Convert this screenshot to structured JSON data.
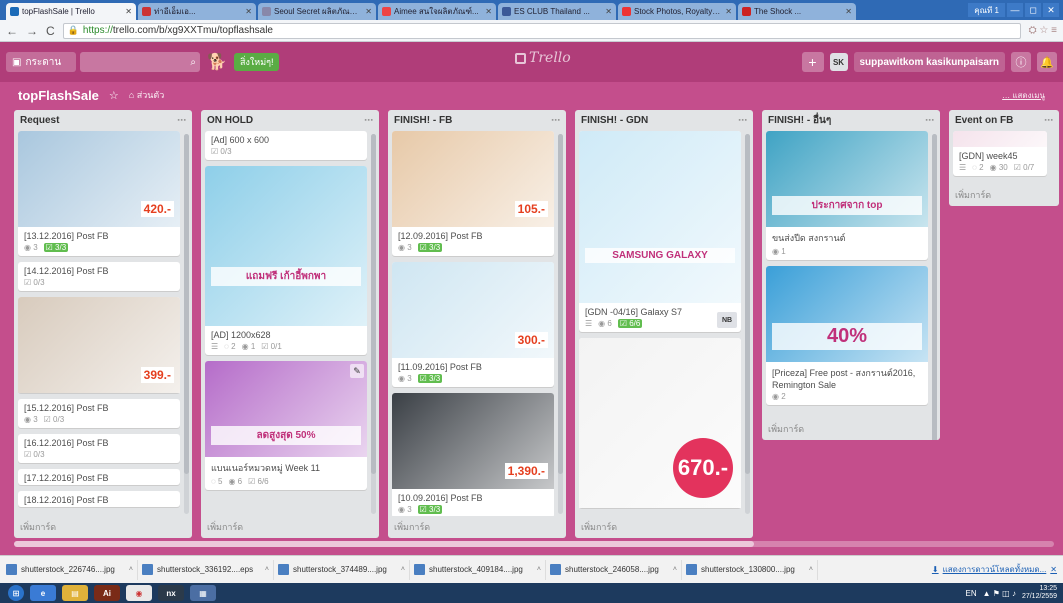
{
  "browser": {
    "tabs": [
      {
        "title": "topFlashSale | Trello",
        "color": "#1c6bb8",
        "active": true
      },
      {
        "title": "ท่าอีเอ็มเอ...",
        "color": "#c33",
        "active": false
      },
      {
        "title": "Seoul Secret ผลิตภัณฑ์...",
        "color": "#88a",
        "active": false
      },
      {
        "title": "Aimee สนใจผลิตภัณฑ์...",
        "color": "#e44",
        "active": false
      },
      {
        "title": "ES CLUB Thailand ...",
        "color": "#3b5998",
        "active": false
      },
      {
        "title": "Stock Photos, Royalty-Fr...",
        "color": "#e33",
        "active": false
      },
      {
        "title": "The Shock ...",
        "color": "#c22",
        "active": false
      }
    ],
    "user": "คุณที 1",
    "min": "—",
    "max": "◻",
    "close": "✕",
    "back": "←",
    "forward": "→",
    "reload": "C",
    "url_scheme": "https://",
    "url_rest": "trello.com/b/xg9XXTmu/topflashsale",
    "ext": "⛭ ☆ ≡"
  },
  "header": {
    "boards_label": "กระดาน",
    "search_icon": "⌕",
    "tip_label": "สิ่งใหม่ๆ!",
    "logo": "Trello",
    "plus": "+",
    "avatar": "SK",
    "username": "suppawitkom kasikunpaisarn",
    "info": "ⓘ",
    "bell": "🔔"
  },
  "board": {
    "title": "topFlashSale",
    "star": "☆",
    "visibility": "⌂ ส่วนตัว",
    "menu": "… แสดงเมนู"
  },
  "lists": [
    {
      "name": "Request",
      "add": "เพิ่มการ์ด",
      "cards": [
        {
          "title": "[13.12.2016] Post FB",
          "img": "#a9c7de",
          "price": "420.-",
          "badges": [
            "◉ 3",
            "☑ 3/3"
          ],
          "done": true
        },
        {
          "title": "[14.12.2016] Post FB",
          "badges": [
            "☑ 0/3"
          ],
          "done": false
        },
        {
          "title": "",
          "img": "#d8cbbd",
          "price": "399.-",
          "badges": [],
          "done": false,
          "imgonly": true
        },
        {
          "title": "[15.12.2016] Post FB",
          "badges": [
            "◉ 3",
            "☑ 0/3"
          ],
          "done": false
        },
        {
          "title": "[16.12.2016] Post FB",
          "badges": [
            "☑ 0/3"
          ],
          "done": false
        },
        {
          "title": "[17.12.2016] Post FB",
          "badges": [],
          "done": false
        },
        {
          "title": "[18.12.2016] Post FB",
          "badges": [],
          "done": false
        }
      ]
    },
    {
      "name": "ON HOLD",
      "add": "เพิ่มการ์ด",
      "cards": [
        {
          "title": "[Ad] 600 x 600",
          "badges": [
            "☑ 0/3"
          ],
          "done": false
        },
        {
          "title": "[AD] 1200x628",
          "img": "#8ecfe9",
          "tall": true,
          "banner": "แถมฟรี เก้าอี้พกพา",
          "badges": [
            "☰",
            "◌ 2",
            "◉ 1",
            "☑ 0/1"
          ],
          "done": false
        },
        {
          "title": "แบนเนอร์หมวดหมู่ Week 11",
          "img": "#b56cc9",
          "banner": "ลดสูงสุด 50%",
          "pen": true,
          "badges": [
            "◌ 5",
            "◉ 6",
            "☑ 6/6"
          ],
          "done": false
        }
      ]
    },
    {
      "name": "FINISH! - FB",
      "add": "เพิ่มการ์ด",
      "cards": [
        {
          "title": "[12.09.2016] Post FB",
          "img": "#e7c9a8",
          "price": "105.-",
          "badges": [
            "◉ 3",
            "☑ 3/3"
          ],
          "done": true
        },
        {
          "title": "[11.09.2016] Post FB",
          "img": "#cfe6f2",
          "price": "300.-",
          "badges": [
            "◉ 3",
            "☑ 3/3"
          ],
          "done": true
        },
        {
          "title": "[10.09.2016] Post FB",
          "img": "#3a3f45",
          "price": "1,390.-",
          "badges": [
            "◉ 3",
            "☑ 3/3"
          ],
          "done": true
        }
      ]
    },
    {
      "name": "FINISH! - GDN",
      "add": "เพิ่มการ์ด",
      "cards": [
        {
          "title": "[GDN -04/16] Galaxy S7",
          "img": "#cfeaf7",
          "tall": true,
          "banner": "SAMSUNG GALAXY",
          "member": "NB",
          "badges": [
            "☰",
            "◉ 6",
            "☑ 6/6"
          ],
          "done": true
        },
        {
          "title": "",
          "img": "#f3f3f3",
          "tall": true,
          "circle": "670.-",
          "imgonly": true,
          "badges": [],
          "done": false
        }
      ]
    },
    {
      "name": "FINISH! - อื่นๆ",
      "add": "เพิ่มการ์ด",
      "cards": [
        {
          "title": "ขนส่งปีด สงกรานต์",
          "img": "#3fa3c4",
          "banner": "ประกาศจาก top",
          "badges": [
            "◉ 1"
          ],
          "done": false
        },
        {
          "title": "[Priceza] Free post - สงกรานต์2016, Remington Sale",
          "img": "#3a9fd8",
          "banner": "40%",
          "badges": [
            "◉ 2"
          ],
          "done": false
        }
      ]
    },
    {
      "name": "Event on FB",
      "add": "เพิ่มการ์ด",
      "cards": [
        {
          "title": "[GDN] week45",
          "img": "#f5e3ec",
          "short": true,
          "badges": [
            "☰",
            "◌ 2",
            "◉ 30",
            "☑ 0/7"
          ],
          "done": false
        }
      ]
    }
  ],
  "downloads": [
    {
      "name": "shutterstock_226746....jpg"
    },
    {
      "name": "shutterstock_336192....eps"
    },
    {
      "name": "shutterstock_374489....jpg"
    },
    {
      "name": "shutterstock_409184....jpg"
    },
    {
      "name": "shutterstock_246058....jpg"
    },
    {
      "name": "shutterstock_130800....jpg"
    }
  ],
  "downloads_all": "แสดงการดาวน์โหลดทั้งหมด...",
  "download_all_icon": "⬇",
  "download_close": "✕",
  "taskbar": {
    "lang": "EN",
    "time": "13:25",
    "date": "27/12/2559"
  },
  "colors": {
    "board_bg": "#c44e8c",
    "header": "#b03d79",
    "check_done": "#61bd4f"
  }
}
